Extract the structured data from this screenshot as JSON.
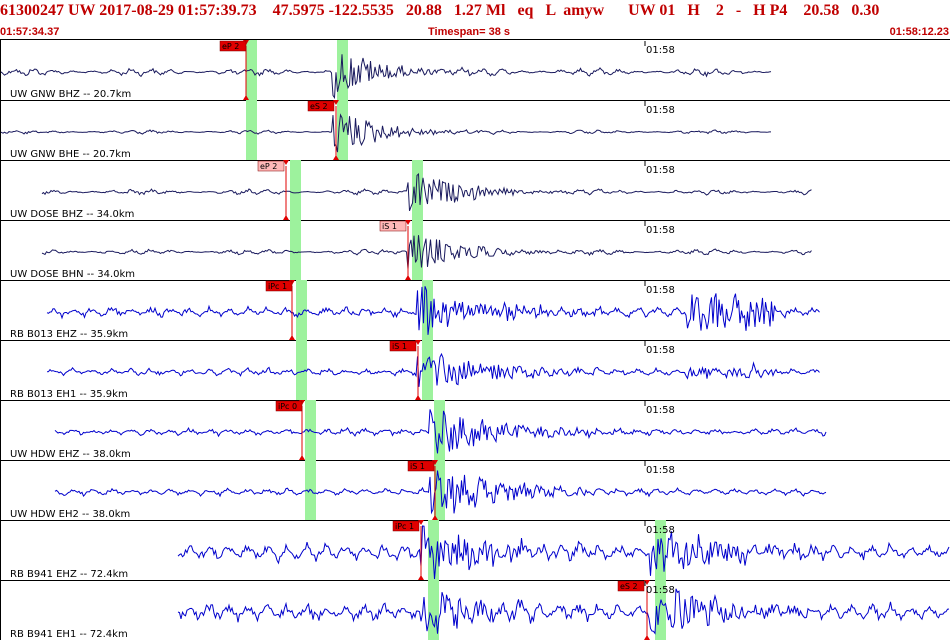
{
  "header": {
    "title": "61300247 UW 2017-08-29 01:57:39.73    47.5975 -122.5535   20.88   1.27 Ml   eq   L  amyw      UW 01   H    2   -   H P4    20.58   0.30",
    "time_start": "01:57:34.37",
    "timespan": "Timespan=  38 s",
    "time_end": "01:58:12.23"
  },
  "colors": {
    "dark_trace": "#1a1a5e",
    "blue_trace": "#0000cc",
    "pick_red": "#e00000",
    "pick_pink": "#ffb8b8",
    "window_green": "#9df29d",
    "accent_red": "#c00000",
    "grid": "#000000"
  },
  "time_mark": "01:58",
  "channels": [
    {
      "label": "UW GNW BHZ -- 20.7km",
      "style": "dark",
      "pick": {
        "label": "eP 2",
        "box": "red"
      }
    },
    {
      "label": "UW GNW BHE -- 20.7km",
      "style": "dark",
      "pick": {
        "label": "eS 2",
        "box": "red"
      }
    },
    {
      "label": "UW DOSE BHZ -- 34.0km",
      "style": "dark",
      "pick": {
        "label": "eP 2",
        "box": "pink"
      }
    },
    {
      "label": "UW DOSE BHN -- 34.0km",
      "style": "dark",
      "pick": {
        "label": "iS 1",
        "box": "pink"
      }
    },
    {
      "label": "RB B013 EHZ -- 35.9km",
      "style": "blue",
      "pick": {
        "label": "iPc 1",
        "box": "red"
      }
    },
    {
      "label": "RB B013 EH1 -- 35.9km",
      "style": "blue",
      "pick": {
        "label": "iS 1",
        "box": "red"
      }
    },
    {
      "label": "UW HDW EHZ -- 38.0km",
      "style": "blue",
      "pick": {
        "label": "iPc 0",
        "box": "red"
      }
    },
    {
      "label": "UW HDW EH2 -- 38.0km",
      "style": "blue",
      "pick": {
        "label": "iS 1",
        "box": "red"
      }
    },
    {
      "label": "RB B941 EHZ -- 72.4km",
      "style": "blue",
      "pick": {
        "label": "iPc 1",
        "box": "red"
      }
    },
    {
      "label": "RB B941 EH1 -- 72.4km",
      "style": "blue",
      "pick": {
        "label": "eS 2",
        "box": "red"
      }
    }
  ]
}
